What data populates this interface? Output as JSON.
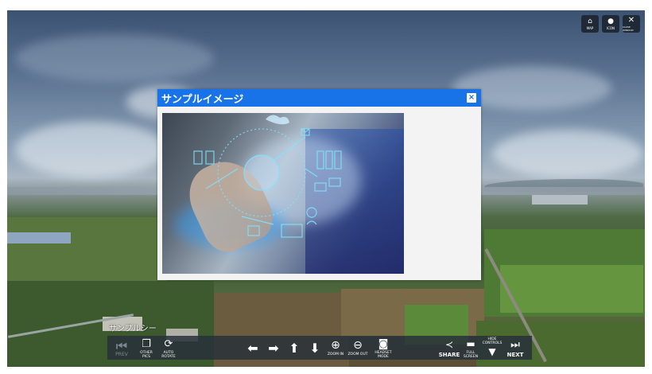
{
  "popup": {
    "title": "サンプルイメージ",
    "close_symbol": "×"
  },
  "hotspot_label": "サンプルシー",
  "top_buttons": [
    {
      "label": "MAP",
      "icon": "map-icon"
    },
    {
      "label": "ICON",
      "icon": "icon-toggle-icon"
    },
    {
      "label": "CLOSE WINDOW",
      "icon": "close-icon"
    }
  ],
  "toolbar": {
    "prev": "PREV",
    "other_pics": "OTHER PICS",
    "auto_rotate": "AUTO ROTATE",
    "zoom_in": "ZOOM IN",
    "zoom_out": "ZOOM OUT",
    "headset_mode": "HEADSET MODE",
    "share": "SHARE",
    "full_screen": "FULL SCREEN",
    "hide_controls": "HIDE CONTROLS",
    "next": "NEXT"
  },
  "colors": {
    "titlebar": "#1873e8",
    "toolbar": "#28303a"
  }
}
